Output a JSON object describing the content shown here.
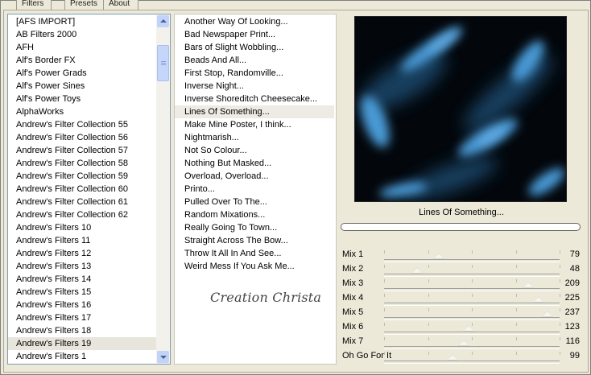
{
  "tabs": [
    {
      "label": "Filters"
    },
    {
      "label": "Presets"
    },
    {
      "label": "About"
    }
  ],
  "categories": {
    "items": [
      "[AFS IMPORT]",
      "AB Filters 2000",
      "AFH",
      "Alf's Border FX",
      "Alf's Power Grads",
      "Alf's Power Sines",
      "Alf's Power Toys",
      "AlphaWorks",
      "Andrew's Filter Collection 55",
      "Andrew's Filter Collection 56",
      "Andrew's Filter Collection 57",
      "Andrew's Filter Collection 58",
      "Andrew's Filter Collection 59",
      "Andrew's Filter Collection 60",
      "Andrew's Filter Collection 61",
      "Andrew's Filter Collection 62",
      "Andrew's Filters 10",
      "Andrew's Filters 11",
      "Andrew's Filters 12",
      "Andrew's Filters 13",
      "Andrew's Filters 14",
      "Andrew's Filters 15",
      "Andrew's Filters 16",
      "Andrew's Filters 17",
      "Andrew's Filters 18",
      "Andrew's Filters 19",
      "Andrew's Filters 1"
    ],
    "selected_index": 25
  },
  "filters": {
    "items": [
      "Another Way Of Looking...",
      "Bad Newspaper Print...",
      "Bars of Slight Wobbling...",
      "Beads And All...",
      "First Stop, Randomville...",
      "Inverse Night...",
      "Inverse Shoreditch Cheesecake...",
      "Lines Of Something...",
      "Make Mine Poster, I think...",
      "Nightmarish...",
      "Not So Colour...",
      "Nothing But Masked...",
      "Overload, Overload...",
      "Printo...",
      "Pulled Over To The...",
      "Random Mixations...",
      "Really Going To Town...",
      "Straight Across The Bow...",
      "Throw It All In And See...",
      "Weird Mess If You Ask Me..."
    ],
    "selected_index": 7,
    "signature": "Creation Christa"
  },
  "preview": {
    "caption": "Lines Of Something...",
    "progress": 0,
    "colors": {
      "dark": "#03070c",
      "accent": "#3f8fc8"
    }
  },
  "sliders": [
    {
      "label": "Mix 1",
      "value": "79"
    },
    {
      "label": "Mix 2",
      "value": "48"
    },
    {
      "label": "Mix 3",
      "value": "209"
    },
    {
      "label": "Mix 4",
      "value": "225"
    },
    {
      "label": "Mix 5",
      "value": "237"
    },
    {
      "label": "Mix 6",
      "value": "123"
    },
    {
      "label": "Mix 7",
      "value": "116"
    },
    {
      "label": "Oh Go For It",
      "value": "99"
    }
  ],
  "slider_max": 255
}
